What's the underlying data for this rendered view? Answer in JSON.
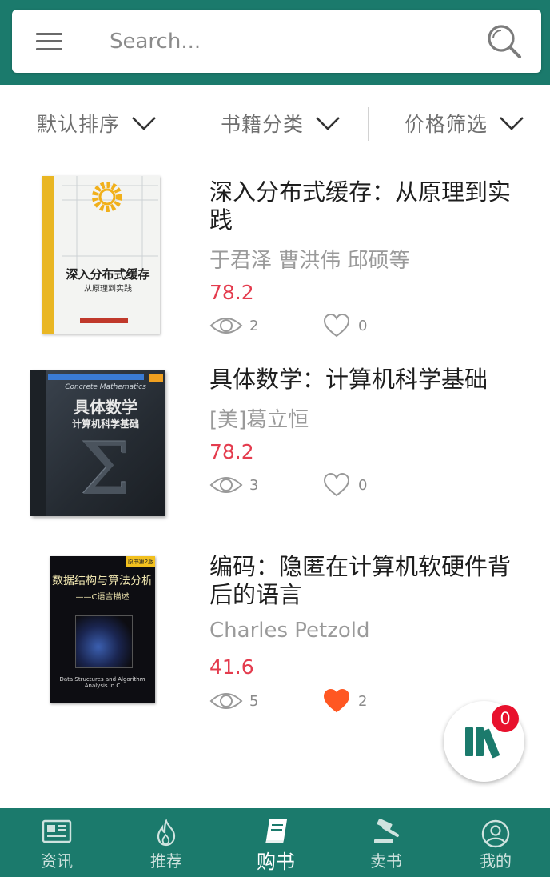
{
  "search": {
    "placeholder": "Search..."
  },
  "filters": [
    {
      "label": "默认排序"
    },
    {
      "label": "书籍分类"
    },
    {
      "label": "价格筛选"
    }
  ],
  "books": [
    {
      "title": "深入分布式缓存：从原理到实践",
      "author": "于君泽 曹洪伟 邱硕等",
      "price": "78.2",
      "views": "2",
      "likes": "0",
      "liked": false,
      "cover": {
        "title": "深入分布式缓存",
        "subtitle": "从原理到实践"
      }
    },
    {
      "title": "具体数学：计算机科学基础",
      "author": "[美]葛立恒",
      "price": "78.2",
      "views": "3",
      "likes": "0",
      "liked": false,
      "cover": {
        "en_title": "Concrete Mathematics",
        "title": "具体数学",
        "subtitle": "计算机科学基础",
        "edition": "第2版",
        "symbol": "Σ"
      }
    },
    {
      "title": "编码：隐匿在计算机软硬件背后的语言",
      "author": "Charles Petzold",
      "price": "41.6",
      "views": "5",
      "likes": "2",
      "liked": true,
      "cover": {
        "title": "数据结构与算法分析",
        "subtitle": "——C语言描述",
        "en_title": "Data Structures and Algorithm Analysis in C",
        "edition": "原书第2版"
      }
    }
  ],
  "cart": {
    "count": "0"
  },
  "nav": [
    {
      "label": "资讯"
    },
    {
      "label": "推荐"
    },
    {
      "label": "购书"
    },
    {
      "label": "卖书"
    },
    {
      "label": "我的"
    }
  ],
  "colors": {
    "primary": "#1b7a6c",
    "price": "#e43c4e",
    "like_active": "#ff5722",
    "badge": "#e8112d"
  }
}
